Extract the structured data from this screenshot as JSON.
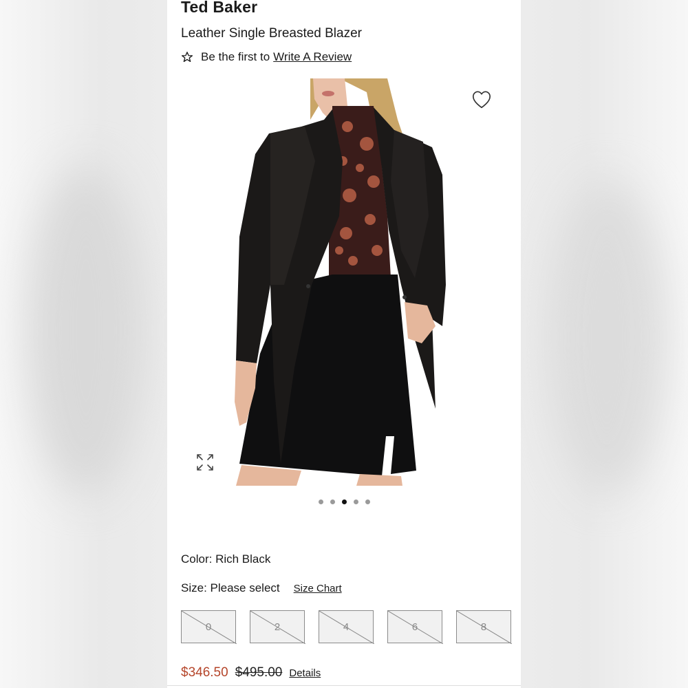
{
  "product": {
    "brand": "Ted Baker",
    "title": "Leather Single Breasted Blazer",
    "review_prefix": "Be the first to",
    "review_link": "Write A Review"
  },
  "gallery": {
    "image_alt": "Model wearing black leather blazer with floral top and black mini skirt",
    "slide_count": 5,
    "active_slide": 3
  },
  "options": {
    "color_label": "Color: Rich Black",
    "size_label": "Size: Please select",
    "size_chart": "Size Chart",
    "sizes": [
      "0",
      "2",
      "4",
      "6",
      "8"
    ]
  },
  "pricing": {
    "sale_price": "$346.50",
    "original_price": "$495.00",
    "details": "Details"
  },
  "colors": {
    "sale": "#b5452a",
    "active_dot": "#111111",
    "inactive_dot": "#9a9a9a"
  }
}
